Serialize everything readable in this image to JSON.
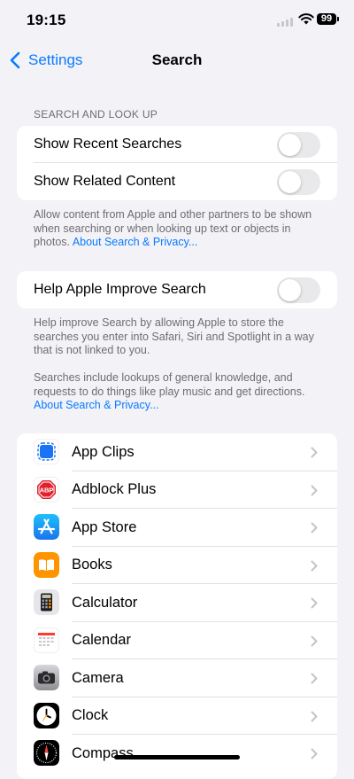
{
  "status": {
    "time": "19:15",
    "battery": "99"
  },
  "nav": {
    "back_label": "Settings",
    "title": "Search"
  },
  "section1": {
    "header": "SEARCH AND LOOK UP",
    "rows": [
      {
        "label": "Show Recent Searches",
        "on": false
      },
      {
        "label": "Show Related Content",
        "on": false
      }
    ],
    "footer_text": "Allow content from Apple and other partners to be shown when searching or when looking up text or objects in photos.",
    "footer_link": "About Search & Privacy..."
  },
  "section2": {
    "row": {
      "label": "Help Apple Improve Search",
      "on": false
    },
    "footer_text1": "Help improve Search by allowing Apple to store the searches you enter into Safari, Siri and Spotlight in a way that is not linked to you.",
    "footer_text2": "Searches include lookups of general knowledge, and requests to do things like play music and get directions.",
    "footer_link": "About Search & Privacy..."
  },
  "apps": [
    {
      "label": "App Clips",
      "icon": "app-clips-icon"
    },
    {
      "label": "Adblock Plus",
      "icon": "adblock-plus-icon"
    },
    {
      "label": "App Store",
      "icon": "app-store-icon"
    },
    {
      "label": "Books",
      "icon": "books-icon"
    },
    {
      "label": "Calculator",
      "icon": "calculator-icon"
    },
    {
      "label": "Calendar",
      "icon": "calendar-icon"
    },
    {
      "label": "Camera",
      "icon": "camera-icon"
    },
    {
      "label": "Clock",
      "icon": "clock-icon"
    },
    {
      "label": "Compass",
      "icon": "compass-icon"
    }
  ],
  "colors": {
    "accent": "#0a7aff",
    "background": "#f2f2f7",
    "secondary_text": "#6d6d72"
  }
}
